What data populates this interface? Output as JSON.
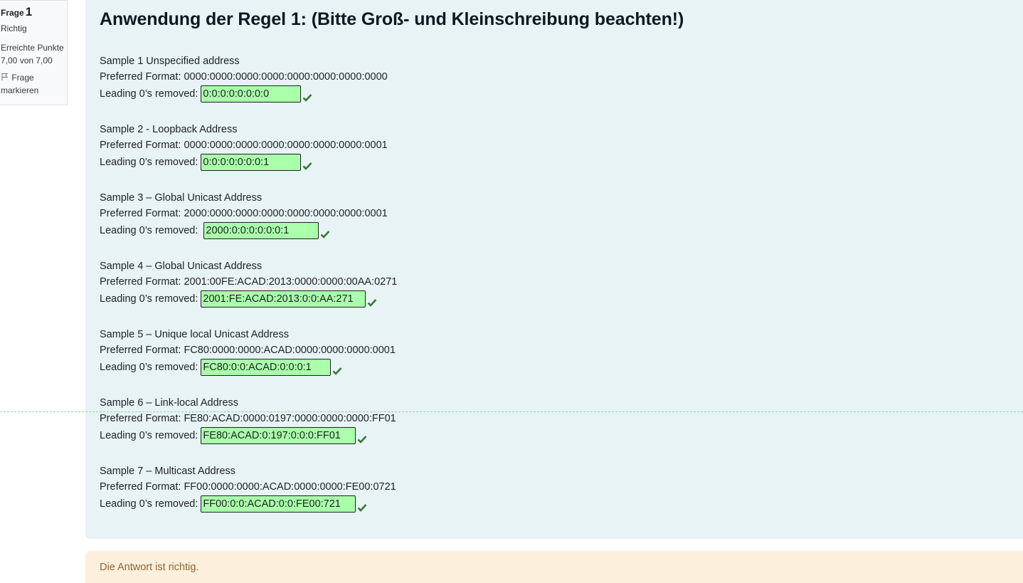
{
  "info": {
    "frage_label": "Frage",
    "frage_number": "1",
    "state": "Richtig",
    "grade_label": "Erreichte Punkte",
    "grade_value": "7,00 von 7,00",
    "flag_line1": "Frage",
    "flag_line2": "markieren"
  },
  "question": {
    "title": "Anwendung der Regel 1: (Bitte Groß- und Kleinschreibung beachten!)",
    "samples": [
      {
        "heading": "Sample 1 Unspecified address",
        "preferred": "Preferred Format: 0000:0000:0000:0000:0000:0000:0000:0000",
        "removed_label": "Leading 0’s removed:",
        "answer": "0:0:0:0:0:0:0:0"
      },
      {
        "heading": "Sample 2 - Loopback Address",
        "preferred": "Preferred Format: 0000:0000:0000:0000:0000:0000:0000:0001",
        "removed_label": "Leading 0’s removed:",
        "answer": "0:0:0:0:0:0:0:1"
      },
      {
        "heading": "Sample 3 – Global Unicast Address",
        "preferred": "Preferred Format: 2000:0000:0000:0000:0000:0000:0000:0001",
        "removed_label": "Leading 0’s removed:",
        "answer": "2000:0:0:0:0:0:0:1"
      },
      {
        "heading": "Sample 4 – Global Unicast Address",
        "preferred": "Preferred Format: 2001:00FE:ACAD:2013:0000:0000:00AA:0271",
        "removed_label": "Leading 0’s removed:",
        "answer": "2001:FE:ACAD:2013:0:0:AA:271"
      },
      {
        "heading": "Sample 5 – Unique local Unicast Address",
        "preferred": "Preferred Format: FC80:0000:0000:ACAD:0000:0000:0000:0001",
        "removed_label": "Leading 0’s removed:",
        "answer": "FC80:0:0:ACAD:0:0:0:1"
      },
      {
        "heading": "Sample 6 – Link-local Address",
        "preferred": "Preferred Format: FE80:ACAD:0000:0197:0000:0000:0000:FF01",
        "removed_label": "Leading 0’s removed:",
        "answer": "FE80:ACAD:0:197:0:0:0:FF01"
      },
      {
        "heading": "Sample 7 – Multicast Address",
        "preferred": "Preferred Format: FF00:0000:0000:ACAD:0000:0000:FE00:0721",
        "removed_label": "Leading 0’s removed:",
        "answer": "FF00:0:0:ACAD:0:0:FE00:721"
      }
    ]
  },
  "feedback": {
    "text": "Die Antwort ist richtig."
  },
  "colors": {
    "correct_fill": "#aaffaa",
    "check": "#357a32",
    "formulation_bg": "#e7f3f5",
    "feedback_bg": "#fcefdc"
  },
  "icons": {
    "flag": "flag-icon",
    "correct": "check-icon"
  }
}
